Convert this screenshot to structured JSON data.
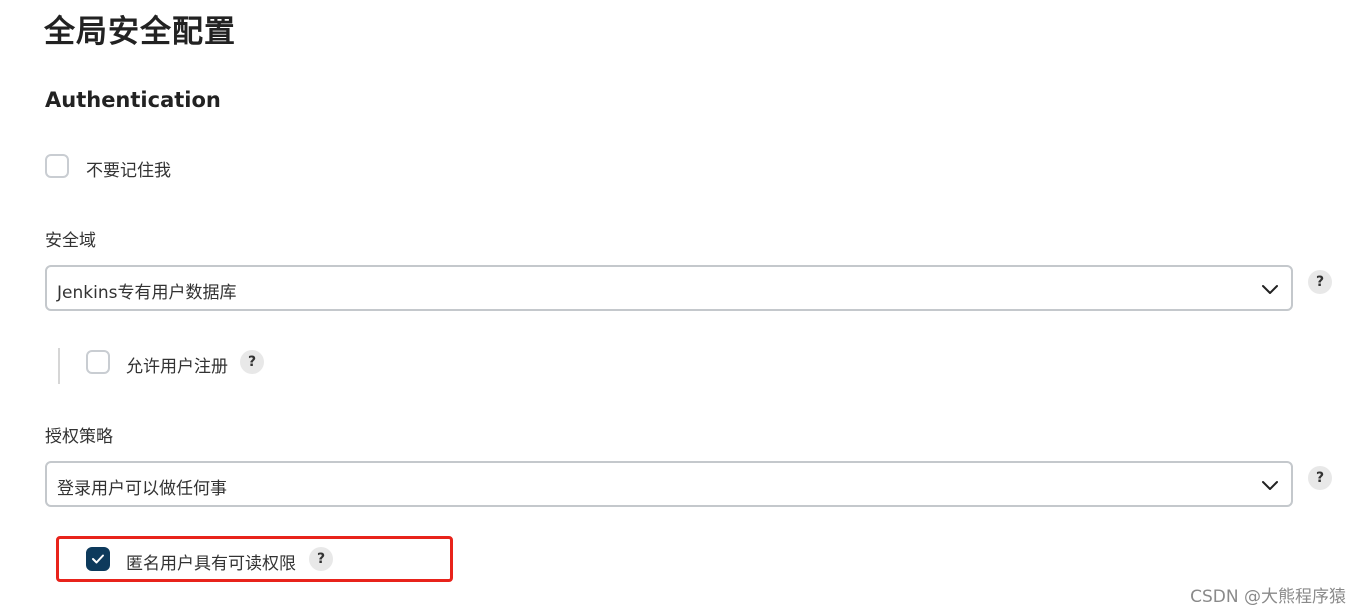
{
  "page": {
    "title": "全局安全配置"
  },
  "authentication": {
    "heading": "Authentication",
    "remember_me": {
      "label": "不要记住我",
      "checked": false
    }
  },
  "security_realm": {
    "label": "安全域",
    "selected": "Jenkins专有用户数据库",
    "help": "?",
    "allow_signup": {
      "label": "允许用户注册",
      "checked": false,
      "help": "?"
    }
  },
  "authorization": {
    "label": "授权策略",
    "selected": "登录用户可以做任何事",
    "help": "?",
    "anonymous_read": {
      "label": "匿名用户具有可读权限",
      "checked": true,
      "help": "?"
    }
  },
  "annotation": {
    "highlight_color": "#e8231b"
  },
  "watermark": {
    "text": "CSDN @大熊程序猿"
  },
  "colors": {
    "checked": "#0d3a5c",
    "border": "#c4c8cc"
  }
}
